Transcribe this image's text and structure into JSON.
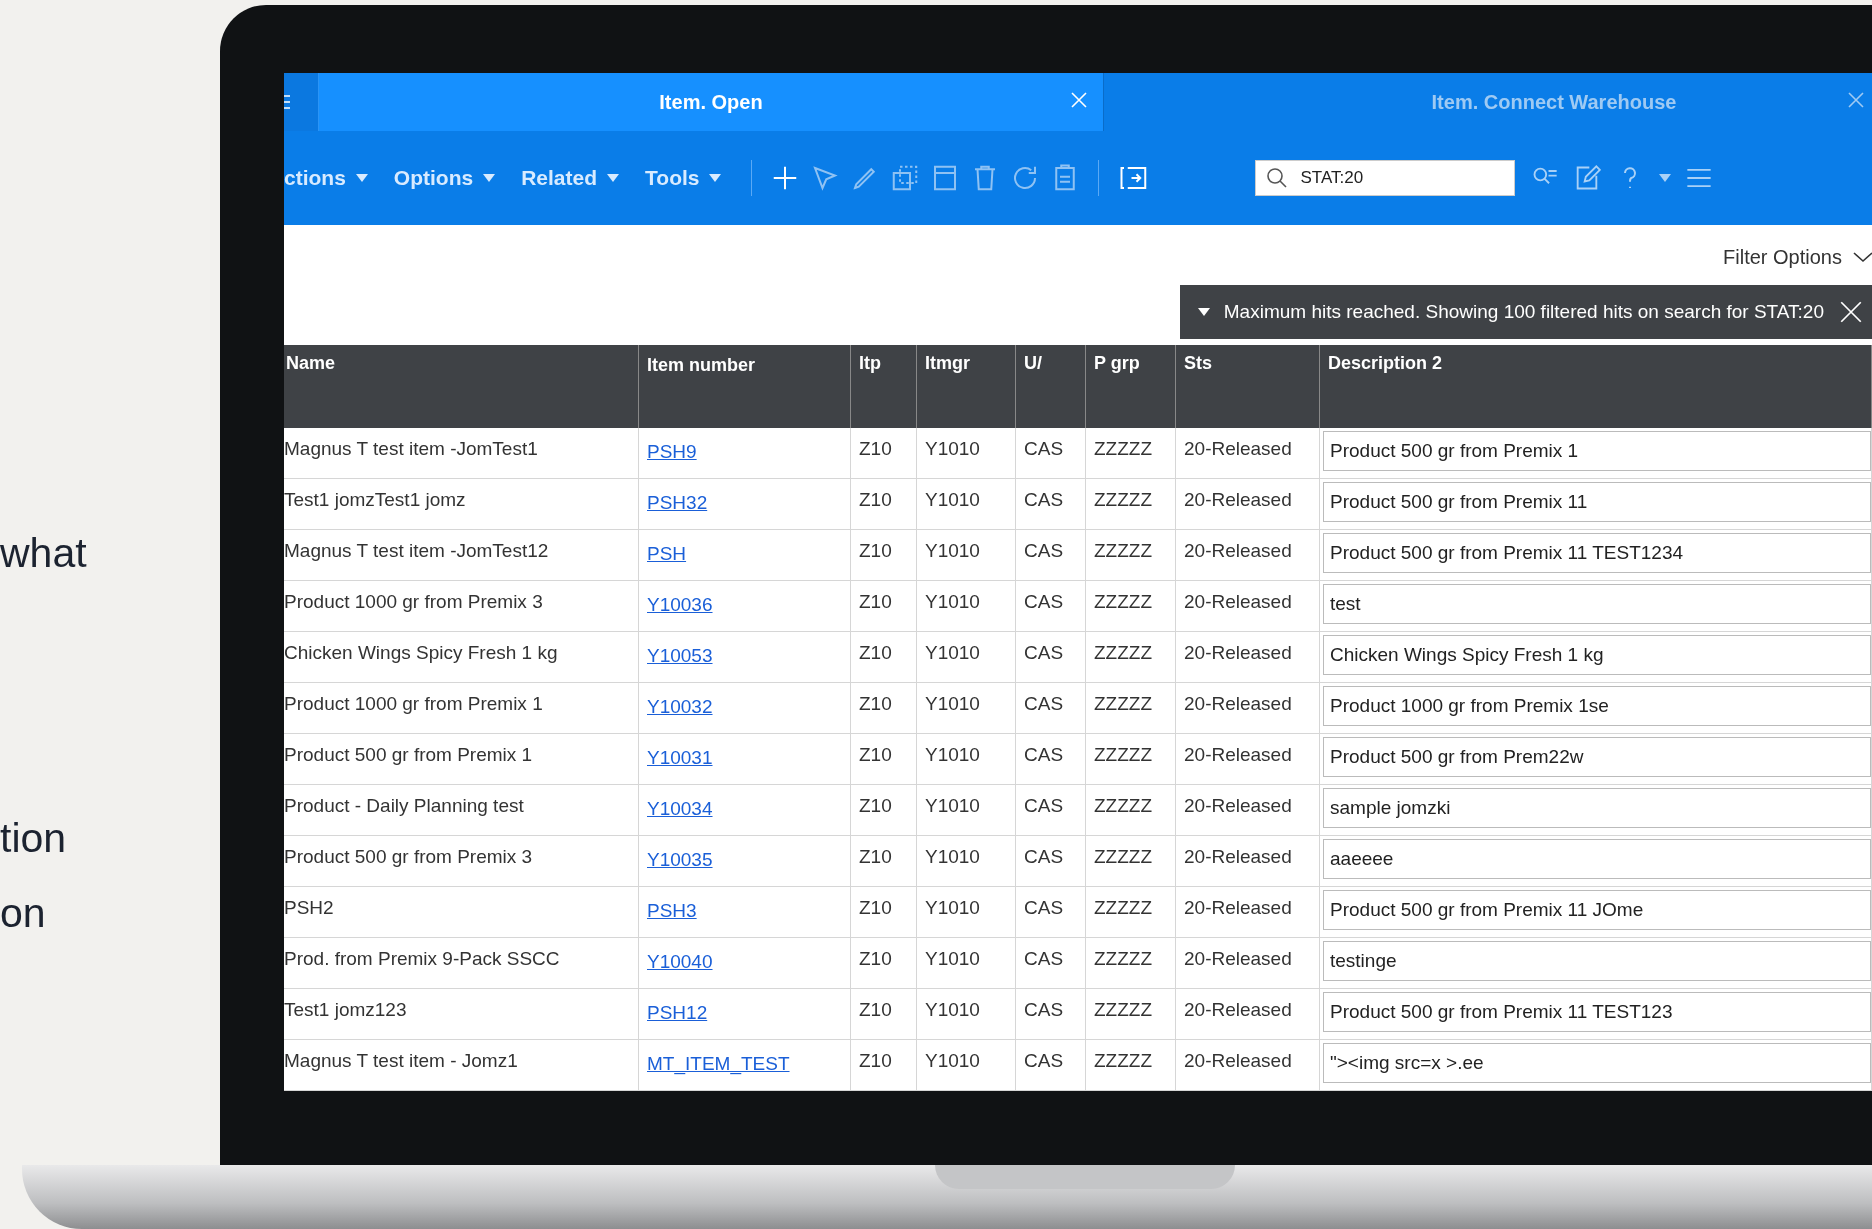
{
  "background_page": {
    "lines": [
      "what",
      "tion",
      "on"
    ]
  },
  "tabs": [
    {
      "label": "Item. Open",
      "selected": true
    },
    {
      "label": "Item. Connect Warehouse",
      "selected": false
    }
  ],
  "menus": [
    "ctions",
    "Options",
    "Related",
    "Tools"
  ],
  "search": {
    "value": "STAT:20"
  },
  "filter_options": "Filter Options",
  "banner": "Maximum hits reached. Showing 100 filtered hits on search for STAT:20",
  "table": {
    "columns": [
      "Name",
      "Item number",
      "Itp",
      "Itmgr",
      "U/",
      "P grp",
      "Sts",
      "Description 2"
    ],
    "rows": [
      [
        "Magnus T test item -JomTest1",
        "PSH9",
        "Z10",
        "Y1010",
        "CAS",
        "ZZZZZ",
        "20-Released",
        "Product 500 gr from Premix 1"
      ],
      [
        "Test1 jomzTest1 jomz",
        "PSH32",
        "Z10",
        "Y1010",
        "CAS",
        "ZZZZZ",
        "20-Released",
        "Product 500 gr from Premix 11"
      ],
      [
        "Magnus T test item -JomTest12",
        "PSH",
        "Z10",
        "Y1010",
        "CAS",
        "ZZZZZ",
        "20-Released",
        "Product 500 gr from Premix 11 TEST1234"
      ],
      [
        "Product 1000 gr from Premix 3",
        "Y10036",
        "Z10",
        "Y1010",
        "CAS",
        "ZZZZZ",
        "20-Released",
        "test"
      ],
      [
        "Chicken Wings Spicy Fresh 1 kg",
        "Y10053",
        "Z10",
        "Y1010",
        "CAS",
        "ZZZZZ",
        "20-Released",
        "Chicken Wings Spicy Fresh 1 kg"
      ],
      [
        "Product 1000 gr from Premix 1",
        "Y10032",
        "Z10",
        "Y1010",
        "CAS",
        "ZZZZZ",
        "20-Released",
        "Product 1000 gr from Premix 1se"
      ],
      [
        "Product 500 gr from Premix 1",
        "Y10031",
        "Z10",
        "Y1010",
        "CAS",
        "ZZZZZ",
        "20-Released",
        "Product 500 gr from Prem22w"
      ],
      [
        "Product - Daily Planning test",
        "Y10034",
        "Z10",
        "Y1010",
        "CAS",
        "ZZZZZ",
        "20-Released",
        "sample jomzki"
      ],
      [
        "Product 500 gr from Premix 3",
        "Y10035",
        "Z10",
        "Y1010",
        "CAS",
        "ZZZZZ",
        "20-Released",
        "aaeeee"
      ],
      [
        "PSH2",
        "PSH3",
        "Z10",
        "Y1010",
        "CAS",
        "ZZZZZ",
        "20-Released",
        "Product 500 gr from Premix 11 JOme"
      ],
      [
        "Prod. from Premix 9-Pack SSCC",
        "Y10040",
        "Z10",
        "Y1010",
        "CAS",
        "ZZZZZ",
        "20-Released",
        "testinge"
      ],
      [
        "Test1 jomz123",
        "PSH12",
        "Z10",
        "Y1010",
        "CAS",
        "ZZZZZ",
        "20-Released",
        "Product 500 gr from Premix 11 TEST123"
      ],
      [
        "Magnus T test item - Jomz1",
        "MT_ITEM_TEST",
        "Z10",
        "Y1010",
        "CAS",
        "ZZZZZ",
        "20-Released",
        "\"><img src=x >.ee"
      ]
    ]
  }
}
